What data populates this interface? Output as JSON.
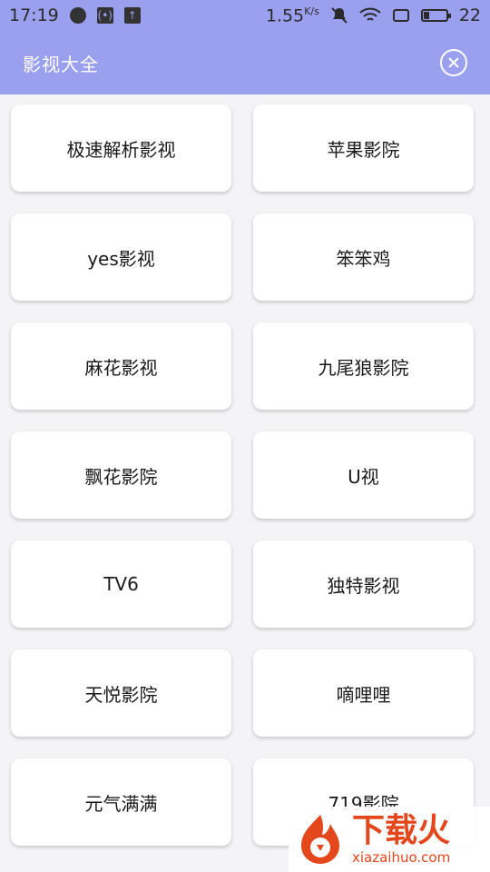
{
  "status_bar": {
    "time": "17:19",
    "speed": "1.55",
    "speed_unit": "K/s",
    "battery_level": "22",
    "battery_fraction": 0.22,
    "icons": [
      "location-icon",
      "signal-icon",
      "upload-icon",
      "mute-icon",
      "wifi-icon",
      "screen-icon",
      "battery-icon"
    ]
  },
  "appbar": {
    "title": "影视大全",
    "close_icon": "close-icon"
  },
  "apps": [
    "极速解析影视",
    "苹果影院",
    "yes影视",
    "笨笨鸡",
    "麻花影视",
    "九尾狼影院",
    "飘花影院",
    "U视",
    "TV6",
    "独特影视",
    "天悦影院",
    "嘀哩哩",
    "元气满满",
    "719影院"
  ],
  "watermark": {
    "name": "下载火",
    "url": "xiazaihuo.com"
  },
  "colors": {
    "accent": "#9a9fee",
    "background": "#f4f4f6",
    "card": "#ffffff",
    "watermark": "#e4471c"
  }
}
